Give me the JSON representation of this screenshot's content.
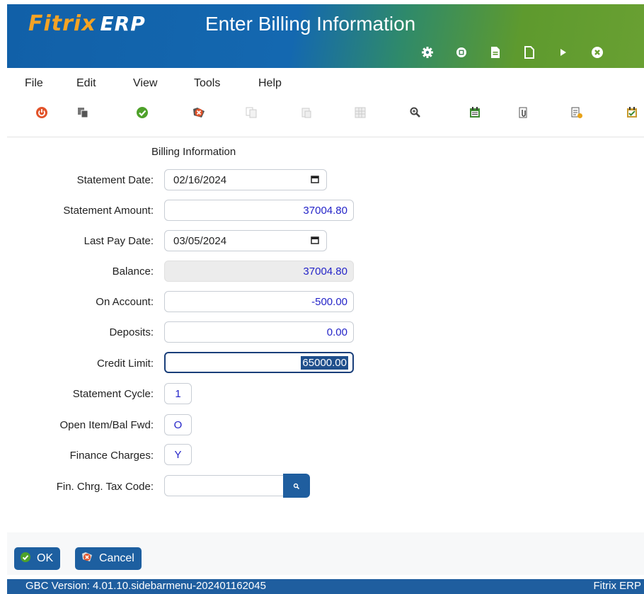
{
  "header": {
    "brand": "Fitrix",
    "brand_suffix": "ERP",
    "title": "Enter Billing Information",
    "icons": [
      "gear-icon",
      "chip-icon",
      "document-icon",
      "blank-document-icon",
      "play-icon",
      "close-circle-icon"
    ]
  },
  "menu": [
    "File",
    "Edit",
    "View",
    "Tools",
    "Help"
  ],
  "toolbar": [
    "power-icon",
    "copy-icon",
    "accept-icon",
    "cancel-icon",
    "duplicate-icon",
    "paste-icon",
    "grid-icon",
    "zoom-icon",
    "calendar-icon",
    "attach-icon",
    "notes-icon",
    "checklist-icon"
  ],
  "form": {
    "section_title": "Billing Information",
    "fields": {
      "statement_date": {
        "label": "Statement Date:",
        "value": "02/16/2024"
      },
      "statement_amount": {
        "label": "Statement Amount:",
        "value": "37004.80"
      },
      "last_pay_date": {
        "label": "Last Pay Date:",
        "value": "03/05/2024"
      },
      "balance": {
        "label": "Balance:",
        "value": "37004.80"
      },
      "on_account": {
        "label": "On Account:",
        "value": "-500.00"
      },
      "deposits": {
        "label": "Deposits:",
        "value": "0.00"
      },
      "credit_limit": {
        "label": "Credit Limit:",
        "value": "65000.00"
      },
      "statement_cycle": {
        "label": "Statement Cycle:",
        "value": "1"
      },
      "open_item": {
        "label": "Open Item/Bal Fwd:",
        "value": "O"
      },
      "finance_charges": {
        "label": "Finance Charges:",
        "value": "Y"
      },
      "fin_tax_code": {
        "label": "Fin. Chrg. Tax Code:",
        "value": ""
      }
    }
  },
  "buttons": {
    "ok": "OK",
    "cancel": "Cancel"
  },
  "status": {
    "version": "GBC Version: 4.01.10.sidebarmenu-202401162045",
    "app": "Fitrix ERP"
  },
  "colors": {
    "accent": "#1f5e9f",
    "brand_orange": "#f4a324",
    "value_text": "#2424c8"
  }
}
